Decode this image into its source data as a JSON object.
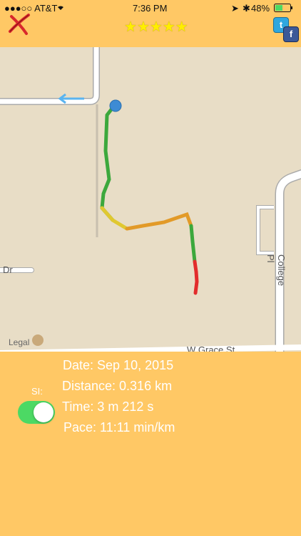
{
  "status_bar": {
    "carrier": "●●●○○ AT&T",
    "time": "7:36 PM",
    "battery": "48%"
  },
  "header": {
    "rating_stars": 5,
    "close_icon": "red-x-icon",
    "share": [
      "twitter-icon",
      "facebook-icon"
    ]
  },
  "map": {
    "labels": {
      "legal": "Legal",
      "dr": "Dr",
      "college": "College Pl",
      "w_grace": "W Grace St"
    },
    "location_dot_color": "#3D8BD4",
    "route_colors": [
      "#2EA83A",
      "#E0D030",
      "#E02A2A"
    ]
  },
  "stats": {
    "date": "Date: Sep 10, 2015",
    "distance": "Distance: 0.316 km",
    "time": "Time: 3 m 212 s",
    "pace": "Pace: 11:11 min/km"
  },
  "units": {
    "label": "SI:",
    "si_enabled": true
  }
}
